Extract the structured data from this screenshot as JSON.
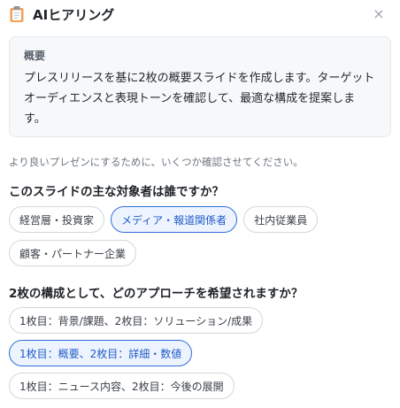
{
  "header": {
    "title": "AIヒアリング",
    "close_label": "×"
  },
  "summary": {
    "label": "概要",
    "text": "プレスリリースを基に2枚の概要スライドを作成します。ターゲットオーディエンスと表現トーンを確認して、最適な構成を提案します。"
  },
  "intro": "より良いプレゼンにするために、いくつか確認させてください。",
  "questions": [
    {
      "text": "このスライドの主な対象者は誰ですか？",
      "options": [
        {
          "label": "経営層・投資家",
          "selected": false
        },
        {
          "label": "メディア・報道関係者",
          "selected": true
        },
        {
          "label": "社内従業員",
          "selected": false
        },
        {
          "label": "顧客・パートナー企業",
          "selected": false
        }
      ]
    },
    {
      "text": "2枚の構成として、どのアプローチを希望されますか？",
      "options": [
        {
          "label": "1枚目：背景/課題、2枚目：ソリューション/成果",
          "selected": false
        },
        {
          "label": "1枚目：概要、2枚目：詳細・数値",
          "selected": true
        },
        {
          "label": "1枚目：ニュース内容、2枚目：今後の展開",
          "selected": false
        }
      ]
    }
  ],
  "colors": {
    "accent": "#2f6ed8",
    "accent_bg": "#eef4ff",
    "card_bg": "#f6f8fa"
  }
}
